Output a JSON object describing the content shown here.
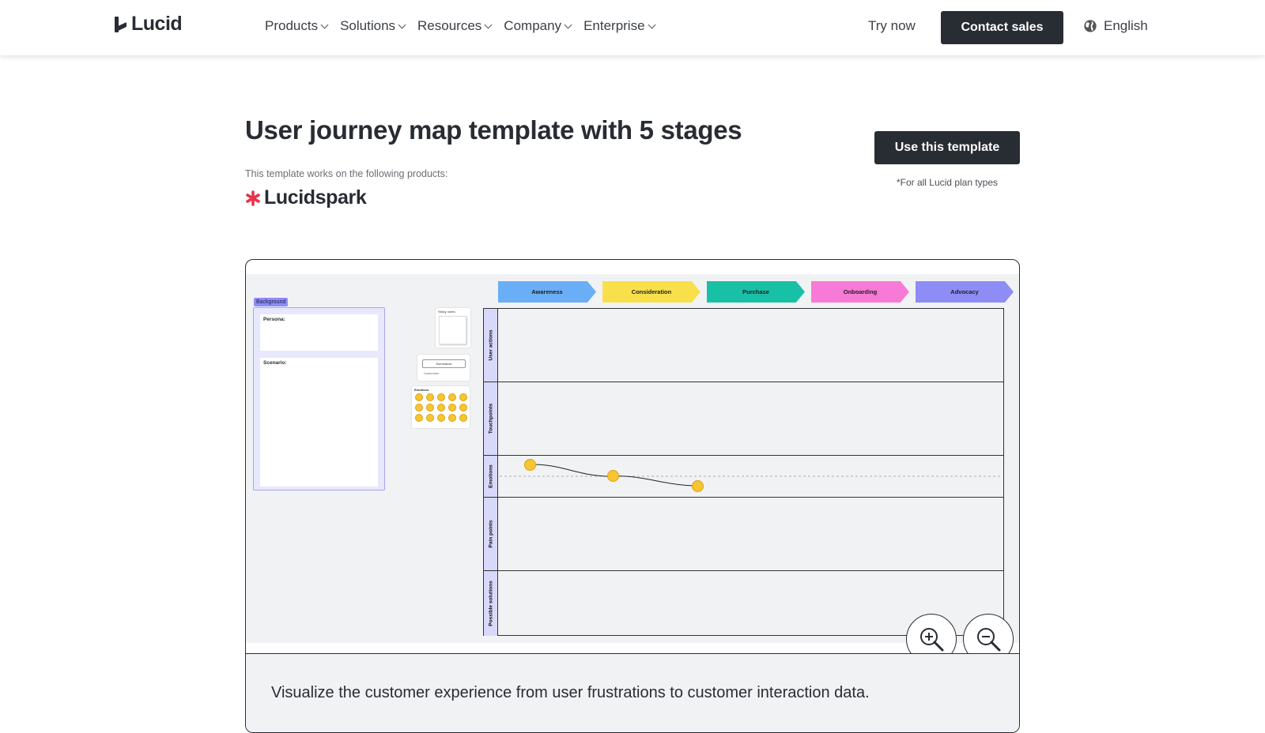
{
  "header": {
    "logo_text": "Lucid",
    "nav": [
      "Products",
      "Solutions",
      "Resources",
      "Company",
      "Enterprise"
    ],
    "try_now": "Try now",
    "contact_sales": "Contact sales",
    "language": "English"
  },
  "template": {
    "title": "User journey map template with 5 stages",
    "works_on": "This template works on the following products:",
    "product": "Lucidspark",
    "use_button": "Use this template",
    "plan_note": "*For all Lucid plan types",
    "description": "Visualize the customer experience from user frustrations to customer interaction data."
  },
  "preview": {
    "background_tag": "Background",
    "persona_label": "Persona:",
    "scenario_label": "Scenario:",
    "sticky_notes_label": "Sticky notes",
    "ai_button_label": "Summarize",
    "ai_sub_label": "Customize",
    "emotions_label": "Emotions",
    "stages": [
      {
        "label": "Awareness",
        "color": "#6aaef7"
      },
      {
        "label": "Consideration",
        "color": "#f9e04b"
      },
      {
        "label": "Purchase",
        "color": "#18c0a6"
      },
      {
        "label": "Onboarding",
        "color": "#f77ad6"
      },
      {
        "label": "Advocacy",
        "color": "#8e8cf5"
      }
    ],
    "rows": [
      "User actions",
      "Touchpoints",
      "Emotions",
      "Pain points",
      "Possible solutions"
    ]
  },
  "colors": {
    "dark_button": "#282c33",
    "canvas_bg": "#f1f2f4",
    "spark_red": "#e8334a"
  },
  "icons": {
    "globe": "globe-icon",
    "zoom_in": "zoom-in-icon",
    "zoom_out": "zoom-out-icon",
    "chevron": "chevron-down-icon"
  }
}
